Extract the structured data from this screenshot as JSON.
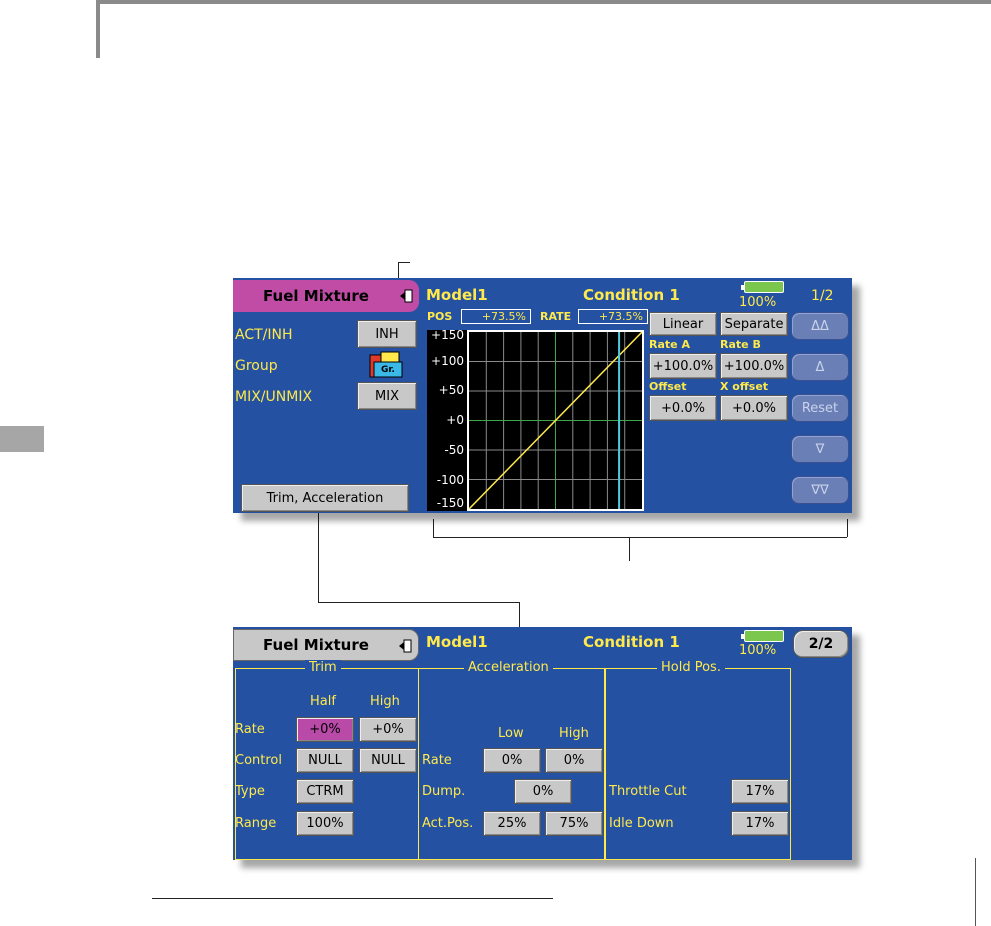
{
  "screen1": {
    "title": "Fuel Mixture",
    "model": "Model1",
    "condition": "Condition 1",
    "battery_pct": "100%",
    "page": "1/2",
    "act_inh_label": "ACT/INH",
    "act_inh_value": "INH",
    "group_label": "Group",
    "group_icon_text": "Gr.",
    "mix_label": "MIX/UNMIX",
    "mix_value": "MIX",
    "trim_button": "Trim, Acceleration",
    "pos_label": "POS",
    "pos_value": "+73.5%",
    "rate_label": "RATE",
    "rate_value": "+73.5%",
    "y_ticks": [
      "+150",
      "+100",
      "+50",
      "+0",
      "-50",
      "-100",
      "-150"
    ],
    "linear_button": "Linear",
    "separate_button": "Separate",
    "rate_a_label": "Rate A",
    "rate_b_label": "Rate B",
    "rate_a_value": "+100.0%",
    "rate_b_value": "+100.0%",
    "offset_label": "Offset",
    "x_offset_label": "X offset",
    "offset_value": "+0.0%",
    "x_offset_value": "+0.0%",
    "nav_up2": "ΔΔ",
    "nav_up1": "Δ",
    "nav_reset": "Reset",
    "nav_down1": "∇",
    "nav_down2": "∇∇"
  },
  "screen2": {
    "title": "Fuel Mixture",
    "model": "Model1",
    "condition": "Condition 1",
    "battery_pct": "100%",
    "page_button": "2/2",
    "trim": {
      "title": "Trim",
      "col_half": "Half",
      "col_high": "High",
      "rate_label": "Rate",
      "rate_half": "+0%",
      "rate_high": "+0%",
      "control_label": "Control",
      "control_half": "NULL",
      "control_high": "NULL",
      "type_label": "Type",
      "type_value": "CTRM",
      "range_label": "Range",
      "range_value": "100%"
    },
    "accel": {
      "title": "Acceleration",
      "col_low": "Low",
      "col_high": "High",
      "rate_label": "Rate",
      "rate_low": "0%",
      "rate_high": "0%",
      "dump_label": "Dump.",
      "dump_value": "0%",
      "actpos_label": "Act.Pos.",
      "actpos_low": "25%",
      "actpos_high": "75%"
    },
    "hold": {
      "title": "Hold Pos.",
      "throttle_cut_label": "Throttle Cut",
      "throttle_cut_value": "17%",
      "idle_down_label": "Idle Down",
      "idle_down_value": "17%"
    }
  },
  "colors": {
    "screen_bg": "#2451a2",
    "label_yellow": "#ffe94b",
    "tab_pink": "#c04ca6",
    "button_gray": "#c8c8c8",
    "battery_green": "#7bc74d"
  },
  "curve": {
    "position_pct": 73.5,
    "rate_pct": 73.5
  }
}
